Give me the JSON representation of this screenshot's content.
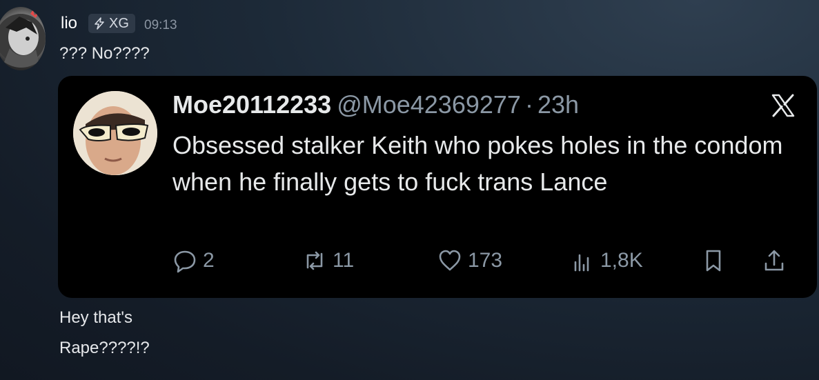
{
  "author": {
    "username": "lio",
    "tag": "XG",
    "tag_icon": "bolt-icon",
    "timestamp": "09:13"
  },
  "messages": {
    "first": "??? No????",
    "second": "Hey that's",
    "third": "Rape????!?"
  },
  "embed": {
    "display_name": "Moe20112233",
    "handle": "@Moe42369277",
    "separator": "·",
    "age": "23h",
    "platform_icon": "x-logo-icon",
    "text": "Obsessed stalker Keith who pokes holes in the condom when he finally gets to fuck trans Lance",
    "stats": {
      "replies": "2",
      "reposts": "11",
      "likes": "173",
      "views": "1,8K"
    }
  },
  "colors": {
    "background": "#1c2937",
    "embed_background": "#000000",
    "muted_text": "#8b98a5",
    "tag_background": "#2e3947"
  }
}
